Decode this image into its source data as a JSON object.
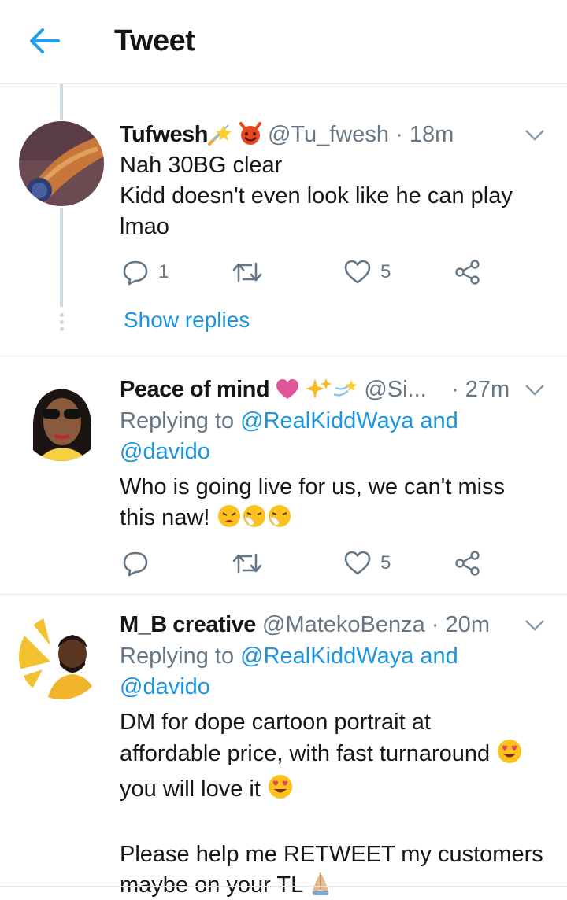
{
  "header": {
    "title": "Tweet",
    "back_icon": "arrow-left-icon",
    "accent": "#1da1f2"
  },
  "thread": {
    "show_replies": "Show replies"
  },
  "tweets": [
    {
      "name": "Tufwesh",
      "name_emojis": [
        "comet-emoji",
        "smiling-imp-emoji"
      ],
      "handle": "@Tu_fwesh",
      "time": "· 18m",
      "lines": [
        "Nah 30BG clear",
        "Kidd doesn't even look like he can play",
        "lmao"
      ],
      "replies": "1",
      "retweets": "",
      "likes": "5"
    },
    {
      "name": "Peace of mind",
      "name_emojis": [
        "heart-emoji",
        "sparkles-emoji",
        "dizzy-emoji"
      ],
      "handle": "@Si...",
      "time": "· 27m",
      "replying_label": "Replying to",
      "replying_user": "@RealKiddWaya",
      "replying_and": "and",
      "replying_user2": "@davido",
      "lines": [
        "Who is going live for us, we can't miss",
        "this naw!"
      ],
      "trailing_emojis": [
        "tired-face-emoji",
        "sneezing-face-emoji",
        "sneezing-face-emoji"
      ],
      "replies": "",
      "retweets": "",
      "likes": "5"
    },
    {
      "name": "M_B creative",
      "handle": "@MatekoBenza",
      "time": "· 20m",
      "replying_label": "Replying to",
      "replying_user": "@RealKiddWaya",
      "replying_and": "and",
      "replying_user2": "@davido",
      "lines": [
        "DM for dope cartoon portrait at",
        "affordable price, with fast turnaround",
        "you will love it",
        "",
        "Please help me RETWEET my customers",
        "maybe on your TL"
      ],
      "line_emojis": [
        "heart-eyes-emoji",
        "heart-eyes-emoji",
        "folded-hands-emoji"
      ]
    }
  ]
}
